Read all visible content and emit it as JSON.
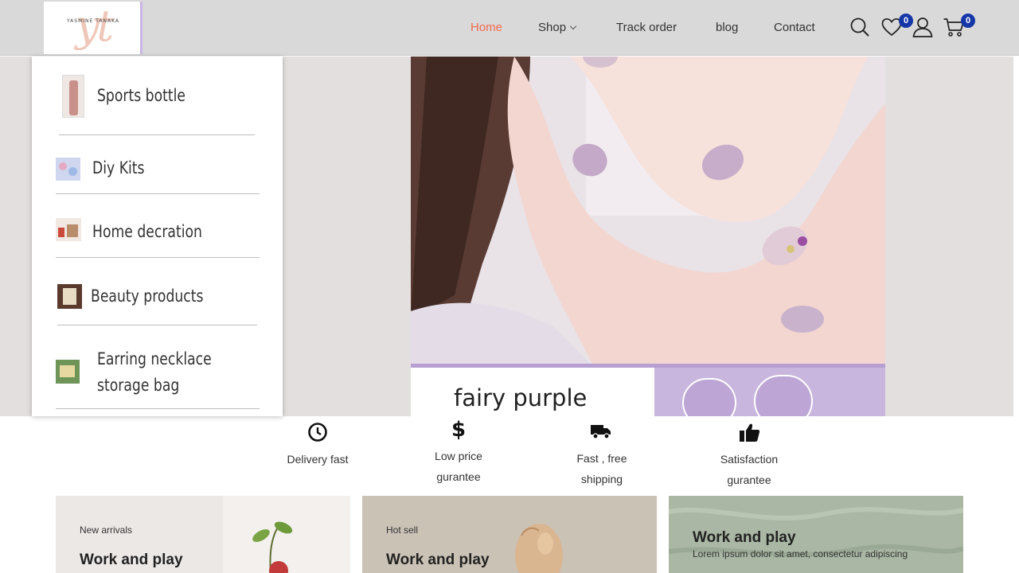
{
  "logo": {
    "monogram": "yt",
    "brand": "YASMINE TANAKA"
  },
  "nav": {
    "home": "Home",
    "shop": "Shop",
    "track": "Track order",
    "blog": "blog",
    "contact": "Contact"
  },
  "header_icons": {
    "search": "search-icon",
    "wishlist": "heart-icon",
    "wishlist_count": "0",
    "account": "user-icon",
    "cart": "cart-icon",
    "cart_count": "0"
  },
  "colors": {
    "active_nav": "#f26b4e",
    "badge": "#1637a8",
    "header_bg": "#d9d9d9",
    "hero_bg": "#e3dfdf",
    "lavender": "#c9b6de"
  },
  "shop_menu": [
    {
      "label": "Sports bottle"
    },
    {
      "label": "Diy Kits"
    },
    {
      "label": "Home decration"
    },
    {
      "label": "Beauty products"
    },
    {
      "label_line1": "Earring necklace",
      "label_line2": "storage bag"
    }
  ],
  "hero": {
    "caption": "fairy purple"
  },
  "features": [
    {
      "icon": "clock-icon",
      "line1": "Delivery fast",
      "line2": ""
    },
    {
      "icon": "dollar-icon",
      "line1": "Low price",
      "line2": "gurantee"
    },
    {
      "icon": "truck-icon",
      "line1": "Fast , free",
      "line2": "shipping"
    },
    {
      "icon": "thumbs-up-icon",
      "line1": "Satisfaction",
      "line2": "gurantee"
    }
  ],
  "cards": [
    {
      "tag": "New arrivals",
      "title": "Work and play",
      "text": ""
    },
    {
      "tag": "Hot sell",
      "title": "Work and play",
      "text": ""
    },
    {
      "tag": "",
      "title": "Work and play",
      "text": "Lorem ipsum dolor sit amet, consectetur adipiscing"
    }
  ]
}
